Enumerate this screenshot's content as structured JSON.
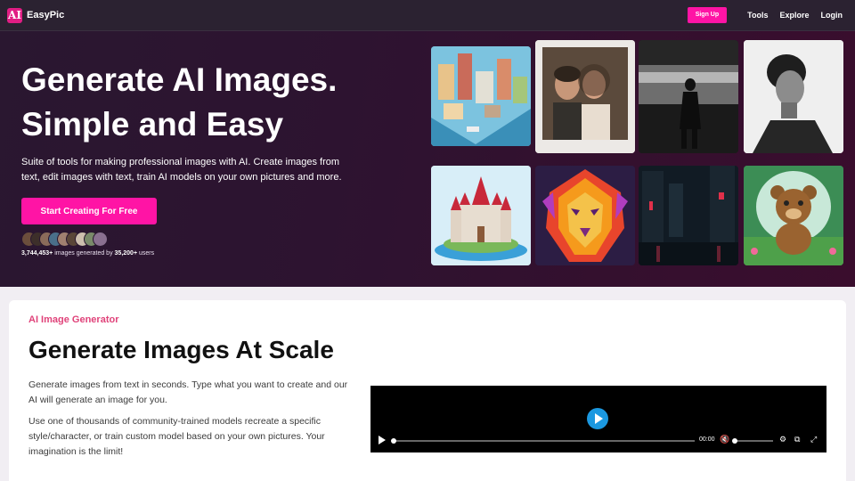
{
  "nav": {
    "logo_text": "AI",
    "brand": "EasyPic",
    "signup_label": "Sign Up",
    "links": [
      "Tools",
      "Explore",
      "Login"
    ]
  },
  "hero": {
    "title": "Generate AI Images. Simple and Easy",
    "description": "Suite of tools for making professional images with AI. Create images from text, edit images with text, train AI models on your own pictures and more.",
    "cta_label": "Start Creating For Free",
    "stats": {
      "images_count": "3,744,453+",
      "images_text": "images generated by",
      "users_count": "35,200+",
      "users_text": "users"
    }
  },
  "gallery": [
    "isometric-city",
    "couple-polaroid",
    "woman-walking-train",
    "man-profile-bw",
    "castle-island",
    "lion-colorful",
    "rainy-neon-street",
    "teddy-bear-forest"
  ],
  "section": {
    "eyebrow": "AI Image Generator",
    "title": "Generate Images At Scale",
    "para1": "Generate images from text in seconds. Type what you want to create and our AI will generate an image for you.",
    "para2": "Use one of thousands of community-trained models recreate a specific style/character, or train custom model based on your own pictures. Your imagination is the limit!"
  },
  "video": {
    "time": "00:00",
    "progress": 0,
    "volume": 0
  },
  "colors": {
    "accent": "#ff14a5",
    "nav_bg": "#2b2231",
    "hero_bg": "#2d1330",
    "eyebrow": "#e0437a",
    "play": "#1b98e0"
  }
}
